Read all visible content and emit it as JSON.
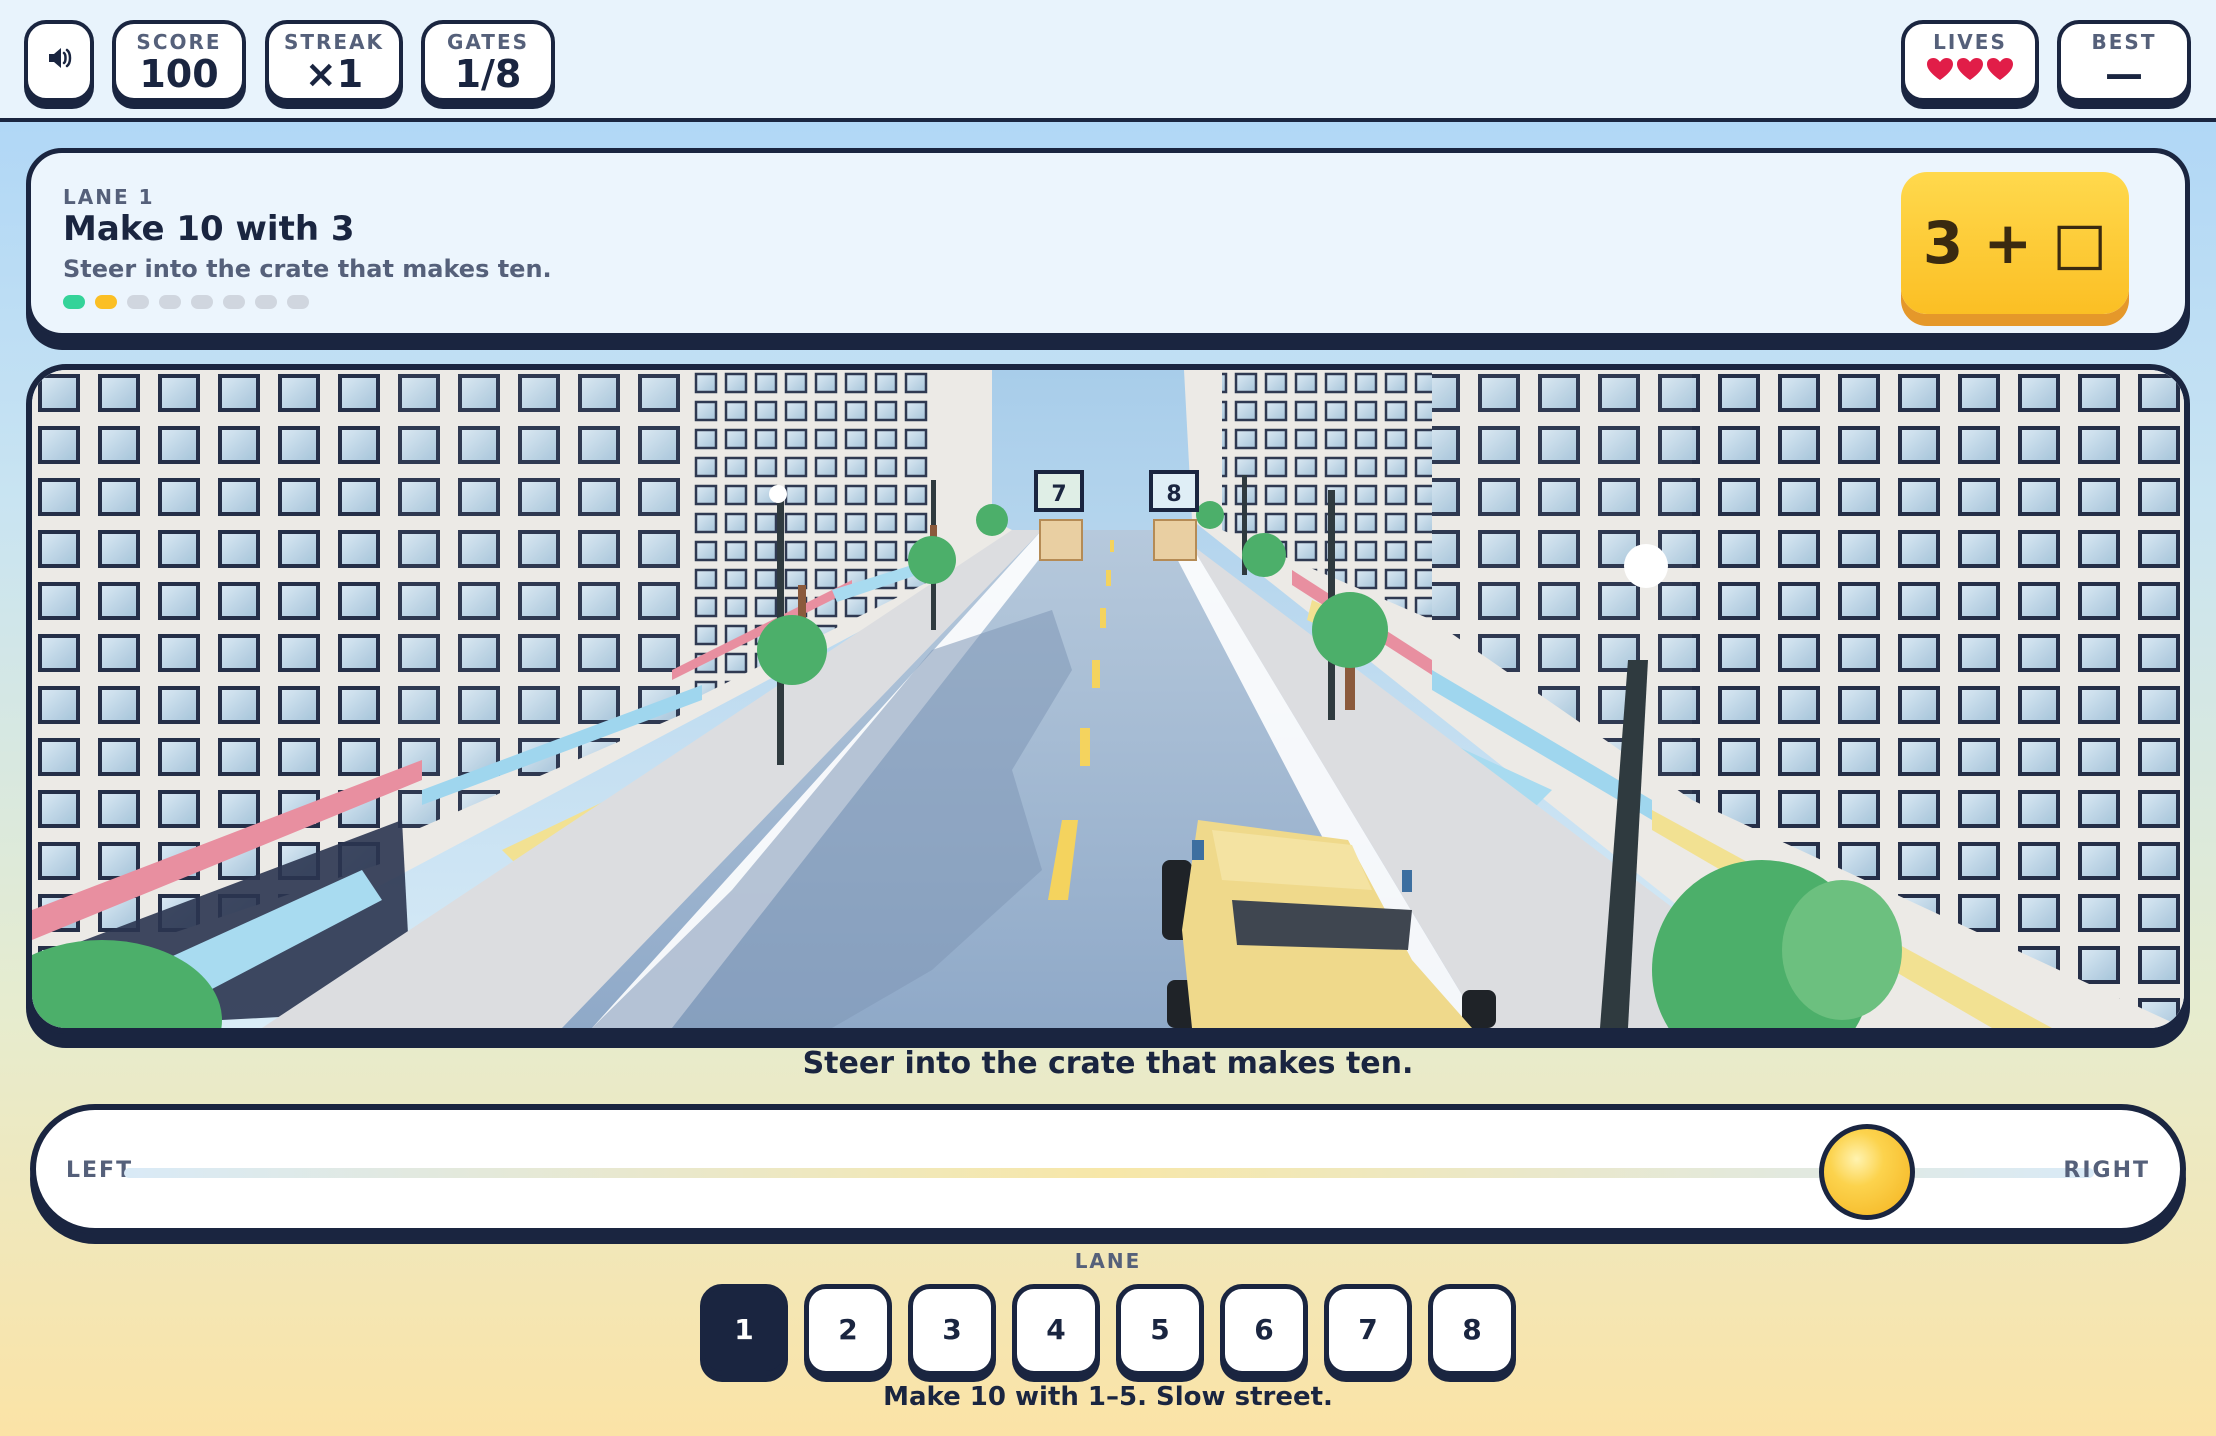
{
  "hud": {
    "sound_icon": "speaker-icon",
    "score": {
      "label": "SCORE",
      "value": "100"
    },
    "streak": {
      "label": "STREAK",
      "value": "×1"
    },
    "gates": {
      "label": "GATES",
      "value": "1/8"
    },
    "lives": {
      "label": "LIVES",
      "count": 3
    },
    "best": {
      "label": "BEST",
      "value": "—"
    }
  },
  "card": {
    "lane_label": "LANE 1",
    "title": "Make 10 with 3",
    "subtitle": "Steer into the crate that makes ten.",
    "progress": {
      "total": 8,
      "done": 1,
      "current": 2
    },
    "equation": "3 + □"
  },
  "scene": {
    "crates": [
      {
        "label": "7"
      },
      {
        "label": "8"
      }
    ]
  },
  "hint": "Steer into the crate that makes ten.",
  "steer": {
    "left_label": "LEFT",
    "right_label": "RIGHT",
    "position": 0.885
  },
  "lane_picker": {
    "label": "LANE",
    "lanes": [
      "1",
      "2",
      "3",
      "4",
      "5",
      "6",
      "7",
      "8"
    ],
    "selected": "1"
  },
  "footer": "Make 10 with 1–5. Slow street.",
  "colors": {
    "ink": "#1a2540",
    "accent": "#fbbf24",
    "dot_done": "#34d399",
    "dot_current": "#fbbf24",
    "heart": "#e11d48"
  }
}
